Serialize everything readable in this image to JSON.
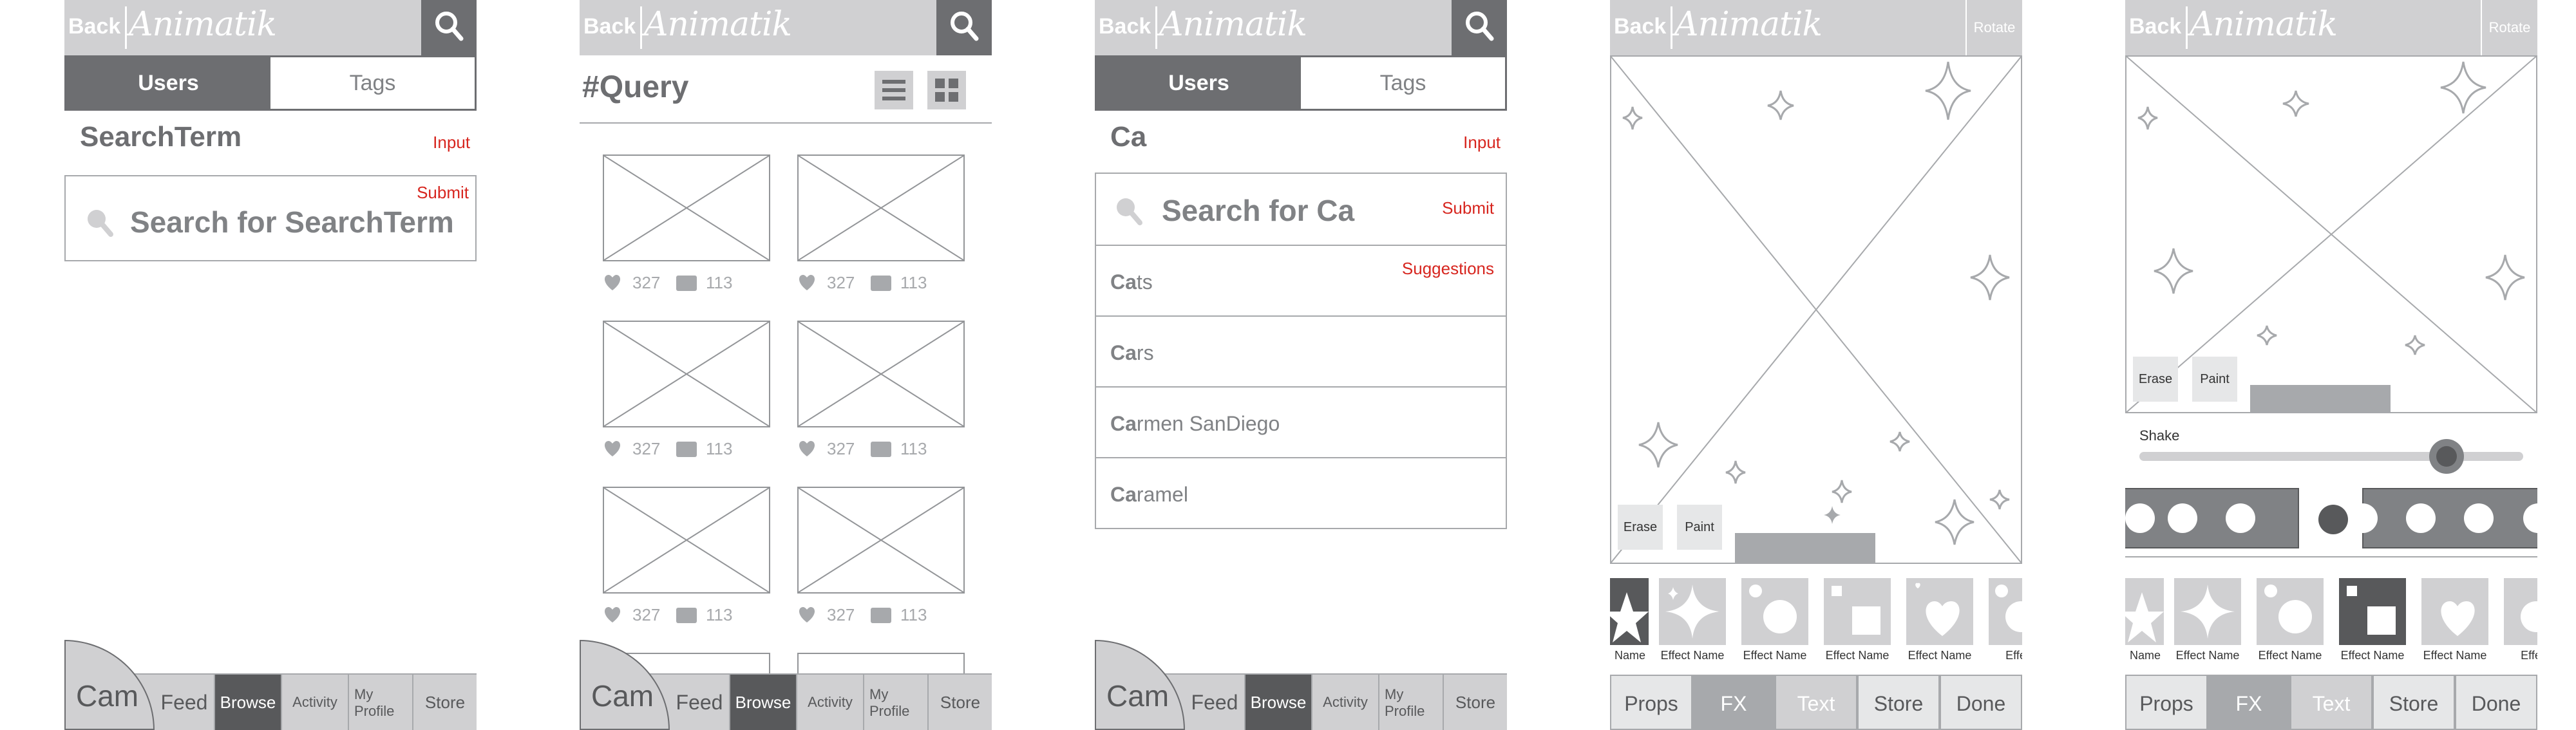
{
  "common": {
    "back": "Back",
    "logo": "Animatik",
    "rotate": "Rotate",
    "tabs": {
      "cam": "Cam",
      "feed": "Feed",
      "browse": "Browse",
      "activity": "Activity",
      "my_profile": "My Profile",
      "store": "Store"
    }
  },
  "screen1": {
    "seg_users": "Users",
    "seg_tags": "Tags",
    "search_term": "SearchTerm",
    "input_note": "Input",
    "search_for": "Search for SearchTerm",
    "submit_note": "Submit"
  },
  "screen2": {
    "title": "#Query",
    "likes": "327",
    "comments": "113"
  },
  "screen3": {
    "seg_users": "Users",
    "seg_tags": "Tags",
    "query": "Ca",
    "input_note": "Input",
    "search_for": "Search for Ca",
    "submit_note": "Submit",
    "suggestions_note": "Suggestions",
    "suggestions": [
      {
        "bold": "Ca",
        "rest": "ts"
      },
      {
        "bold": "Ca",
        "rest": "rs"
      },
      {
        "bold": "Ca",
        "rest": "rmen SanDiego"
      },
      {
        "bold": "Ca",
        "rest": "ramel"
      }
    ]
  },
  "editor": {
    "erase": "Erase",
    "paint": "Paint",
    "effects": [
      "Name",
      "Effect Name",
      "Effect Name",
      "Effect Name",
      "Effect Name",
      "Effect"
    ],
    "toolbar": [
      "Props",
      "FX",
      "Text",
      "Store",
      "Done"
    ]
  },
  "editor2": {
    "erase": "Erase",
    "paint": "Paint",
    "shake": "Shake",
    "effects": [
      "Name",
      "Effect Name",
      "Effect Name",
      "Effect Name",
      "Effect Name",
      "Effect Name",
      "Effect"
    ],
    "toolbar": [
      "Props",
      "FX",
      "Text",
      "Store",
      "Done"
    ]
  }
}
